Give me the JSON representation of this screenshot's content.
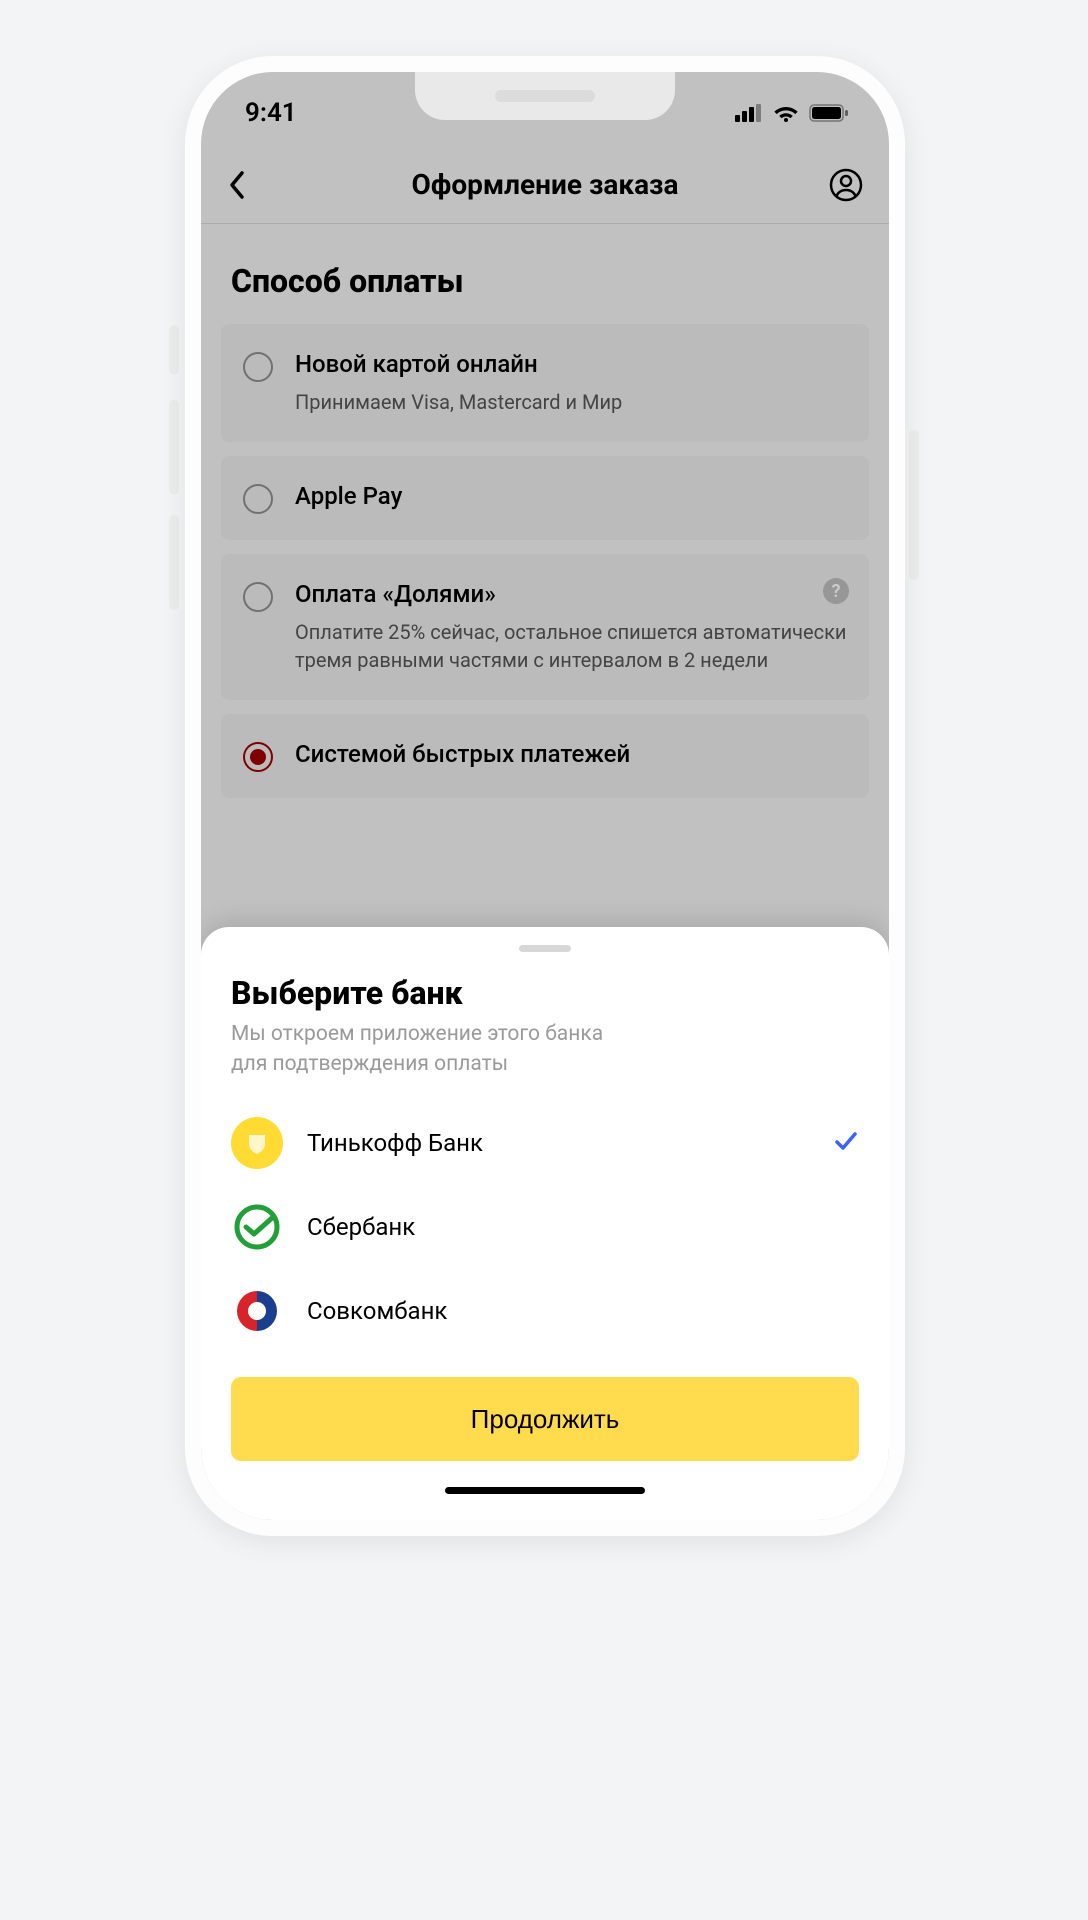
{
  "statusbar": {
    "time": "9:41"
  },
  "header": {
    "title": "Оформление заказа"
  },
  "section_title": "Способ оплаты",
  "options": [
    {
      "title": "Новой картой онлайн",
      "sub": "Принимаем Visa, Mastercard и Мир",
      "checked": false,
      "has_help": false
    },
    {
      "title": "Apple Pay",
      "sub": "",
      "checked": false,
      "has_help": false
    },
    {
      "title": "Оплата «Долями»",
      "sub": "Оплатите 25% сейчас, остальное спишется автоматически тремя равными частями с интервалом в 2 недели",
      "checked": false,
      "has_help": true
    },
    {
      "title": "Системой быстрых платежей",
      "sub": "",
      "checked": true,
      "has_help": false
    }
  ],
  "sheet": {
    "title": "Выберите банк",
    "sub_line1": "Мы откроем приложение этого банка",
    "sub_line2": "для подтверждения оплаты",
    "banks": [
      {
        "name": "Тинькофф Банк",
        "selected": true,
        "logo": "tinkoff"
      },
      {
        "name": "Сбербанк",
        "selected": false,
        "logo": "sber"
      },
      {
        "name": "Совкомбанк",
        "selected": false,
        "logo": "sovcom"
      }
    ],
    "cta": "Продолжить"
  },
  "colors": {
    "accent": "#ffdb4d",
    "selected_radio": "#a10000",
    "check": "#3a62ff"
  }
}
